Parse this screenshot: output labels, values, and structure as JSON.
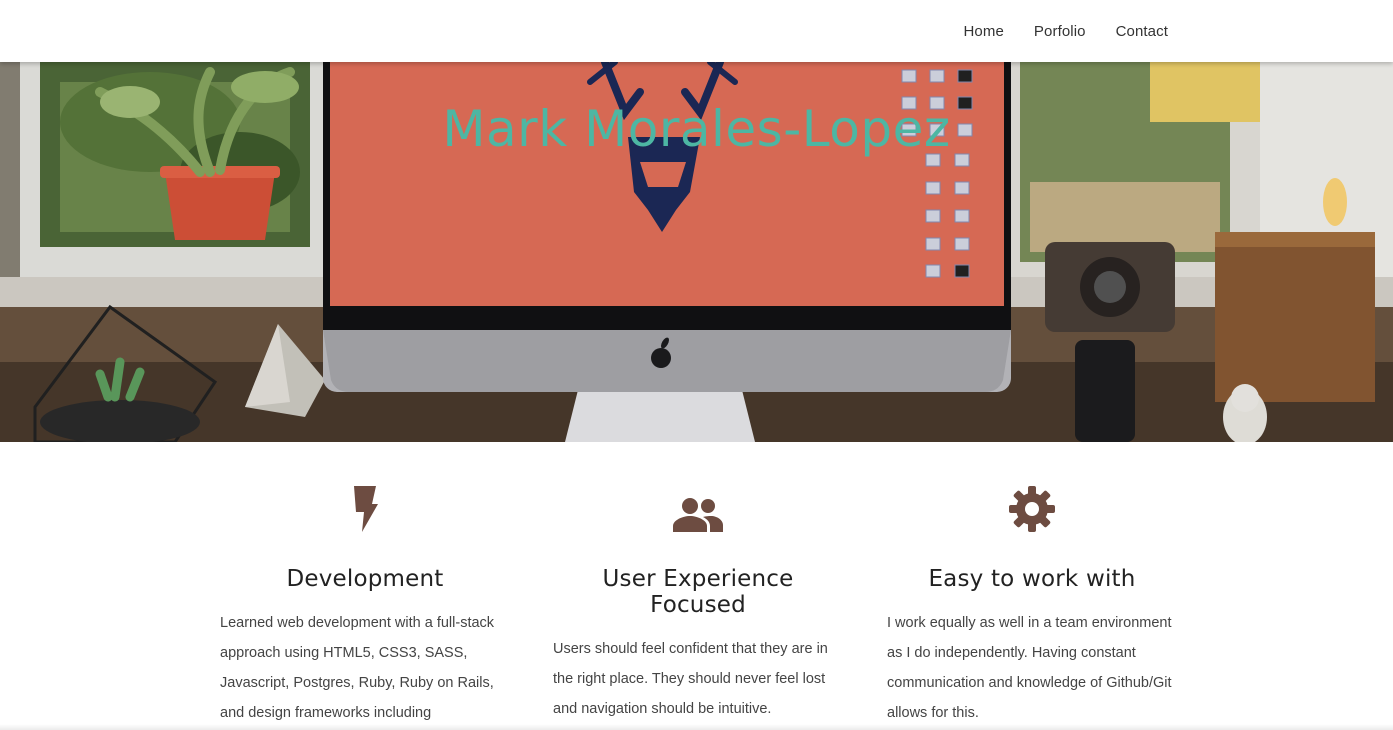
{
  "nav": {
    "links": [
      "Home",
      "Porfolio",
      "Contact"
    ]
  },
  "hero": {
    "title": "Mark Morales-Lopez"
  },
  "features": [
    {
      "icon": "lightning-icon",
      "title": "Development",
      "text": "Learned web development with a full-stack approach using HTML5, CSS3, SASS, Javascript, Postgres, Ruby, Ruby on Rails, and design frameworks including"
    },
    {
      "icon": "people-icon",
      "title": "User Experience Focused",
      "text": "Users should feel confident that they are in the right place. They should never feel lost and navigation should be intuitive."
    },
    {
      "icon": "gear-icon",
      "title": "Easy to work with",
      "text": "I work equally as well in a team environment as I do independently. Having constant communication and knowledge of Github/Git allows for this."
    }
  ],
  "colors": {
    "accent": "#4db6a3",
    "icon": "#6d4c41",
    "screen": "#e4705a"
  }
}
